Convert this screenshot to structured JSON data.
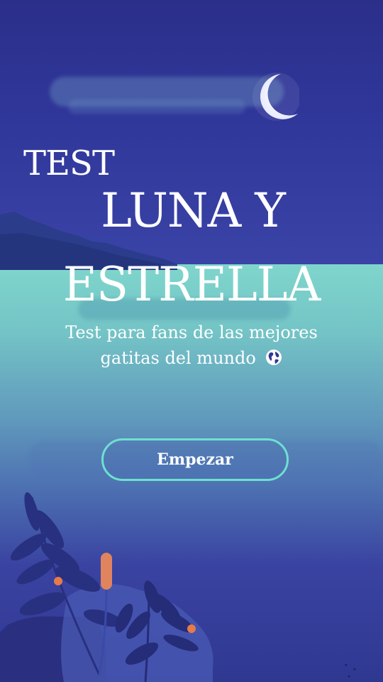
{
  "hero": {
    "title_prefix": "TEST",
    "title_line1": "LUNA Y",
    "title_line2": "ESTRELLA",
    "subtitle_line1": "Test para fans de las mejores",
    "subtitle_line2": "gatitas del mundo"
  },
  "icons": {
    "moon": "moon-icon",
    "globe": "globe-icon"
  },
  "actions": {
    "start_label": "Empezar"
  },
  "colors": {
    "sky_top": "#30379a",
    "sky_mid": "#7fd6cc",
    "sky_bottom": "#2f3891",
    "button_border": "#6ee0d0",
    "text": "#ffffff",
    "accent_orange": "#e87a4a"
  }
}
